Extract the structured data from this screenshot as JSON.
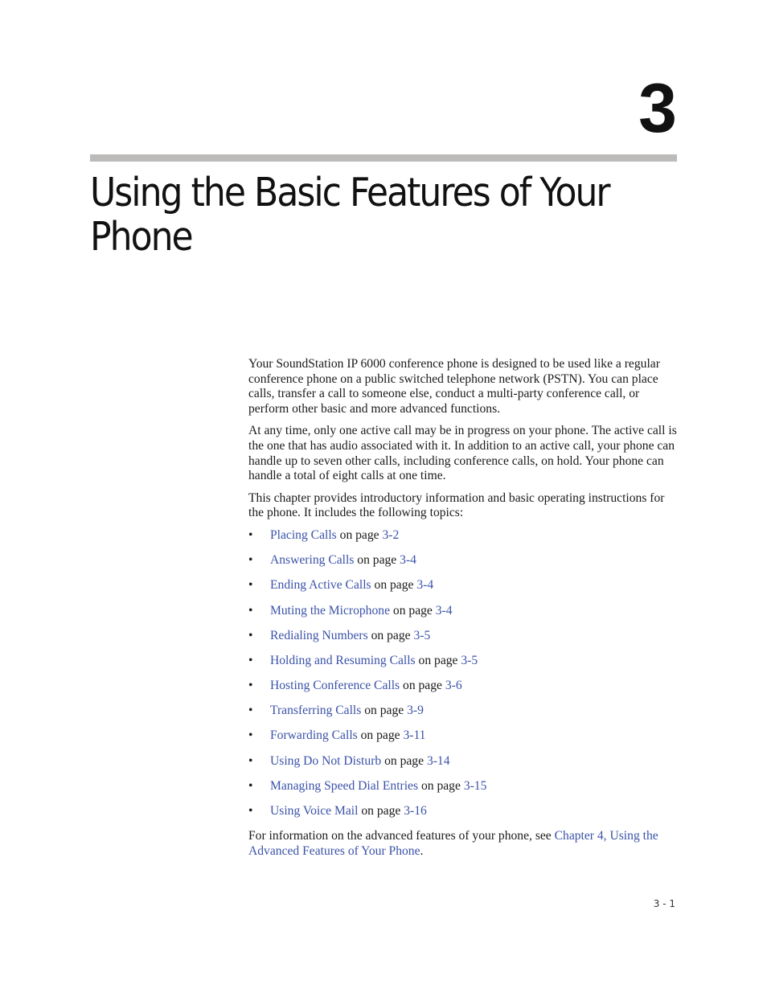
{
  "chapter": {
    "number": "3",
    "title": "Using the Basic Features of Your Phone"
  },
  "intro_paragraphs": [
    "Your SoundStation IP 6000 conference phone is designed to be used like a regular conference phone on a public switched telephone network (PSTN). You can place calls, transfer a call to someone else, conduct a multi-party conference call, or perform other basic and more advanced functions.",
    "At any time, only one active call may be in progress on your phone. The active call is the one that has audio associated with it. In addition to an active call, your phone can handle up to seven other calls, including conference calls, on hold. Your phone can handle a total of eight calls at one time.",
    "This chapter provides introductory information and basic operating instructions for the phone. It includes the following topics:"
  ],
  "topics": [
    {
      "title": "Placing Calls",
      "connector": "on page",
      "page": "3-2"
    },
    {
      "title": "Answering Calls",
      "connector": "on page",
      "page": "3-4"
    },
    {
      "title": "Ending Active Calls",
      "connector": "on page",
      "page": "3-4"
    },
    {
      "title": "Muting the Microphone",
      "connector": "on page",
      "page": "3-4"
    },
    {
      "title": "Redialing Numbers",
      "connector": "on page",
      "page": "3-5"
    },
    {
      "title": "Holding and Resuming Calls",
      "connector": "on page",
      "page": "3-5"
    },
    {
      "title": "Hosting Conference Calls",
      "connector": "on page",
      "page": "3-6"
    },
    {
      "title": "Transferring Calls",
      "connector": "on page",
      "page": "3-9"
    },
    {
      "title": "Forwarding Calls",
      "connector": "on page",
      "page": "3-11"
    },
    {
      "title": "Using Do Not Disturb",
      "connector": "on page",
      "page": "3-14"
    },
    {
      "title": "Managing Speed Dial Entries",
      "connector": "on page",
      "page": "3-15"
    },
    {
      "title": "Using Voice Mail",
      "connector": "on page",
      "page": "3-16"
    }
  ],
  "bullet_glyph": "•",
  "closing": {
    "prefix": "For information on the advanced features of your phone, see ",
    "link": "Chapter 4, Using the Advanced Features of Your Phone",
    "suffix": "."
  },
  "footer": {
    "page_number": "3 - 1"
  },
  "colors": {
    "link": "#3a52a8",
    "rule": "#bdbbb9",
    "text": "#1a1a1a"
  }
}
